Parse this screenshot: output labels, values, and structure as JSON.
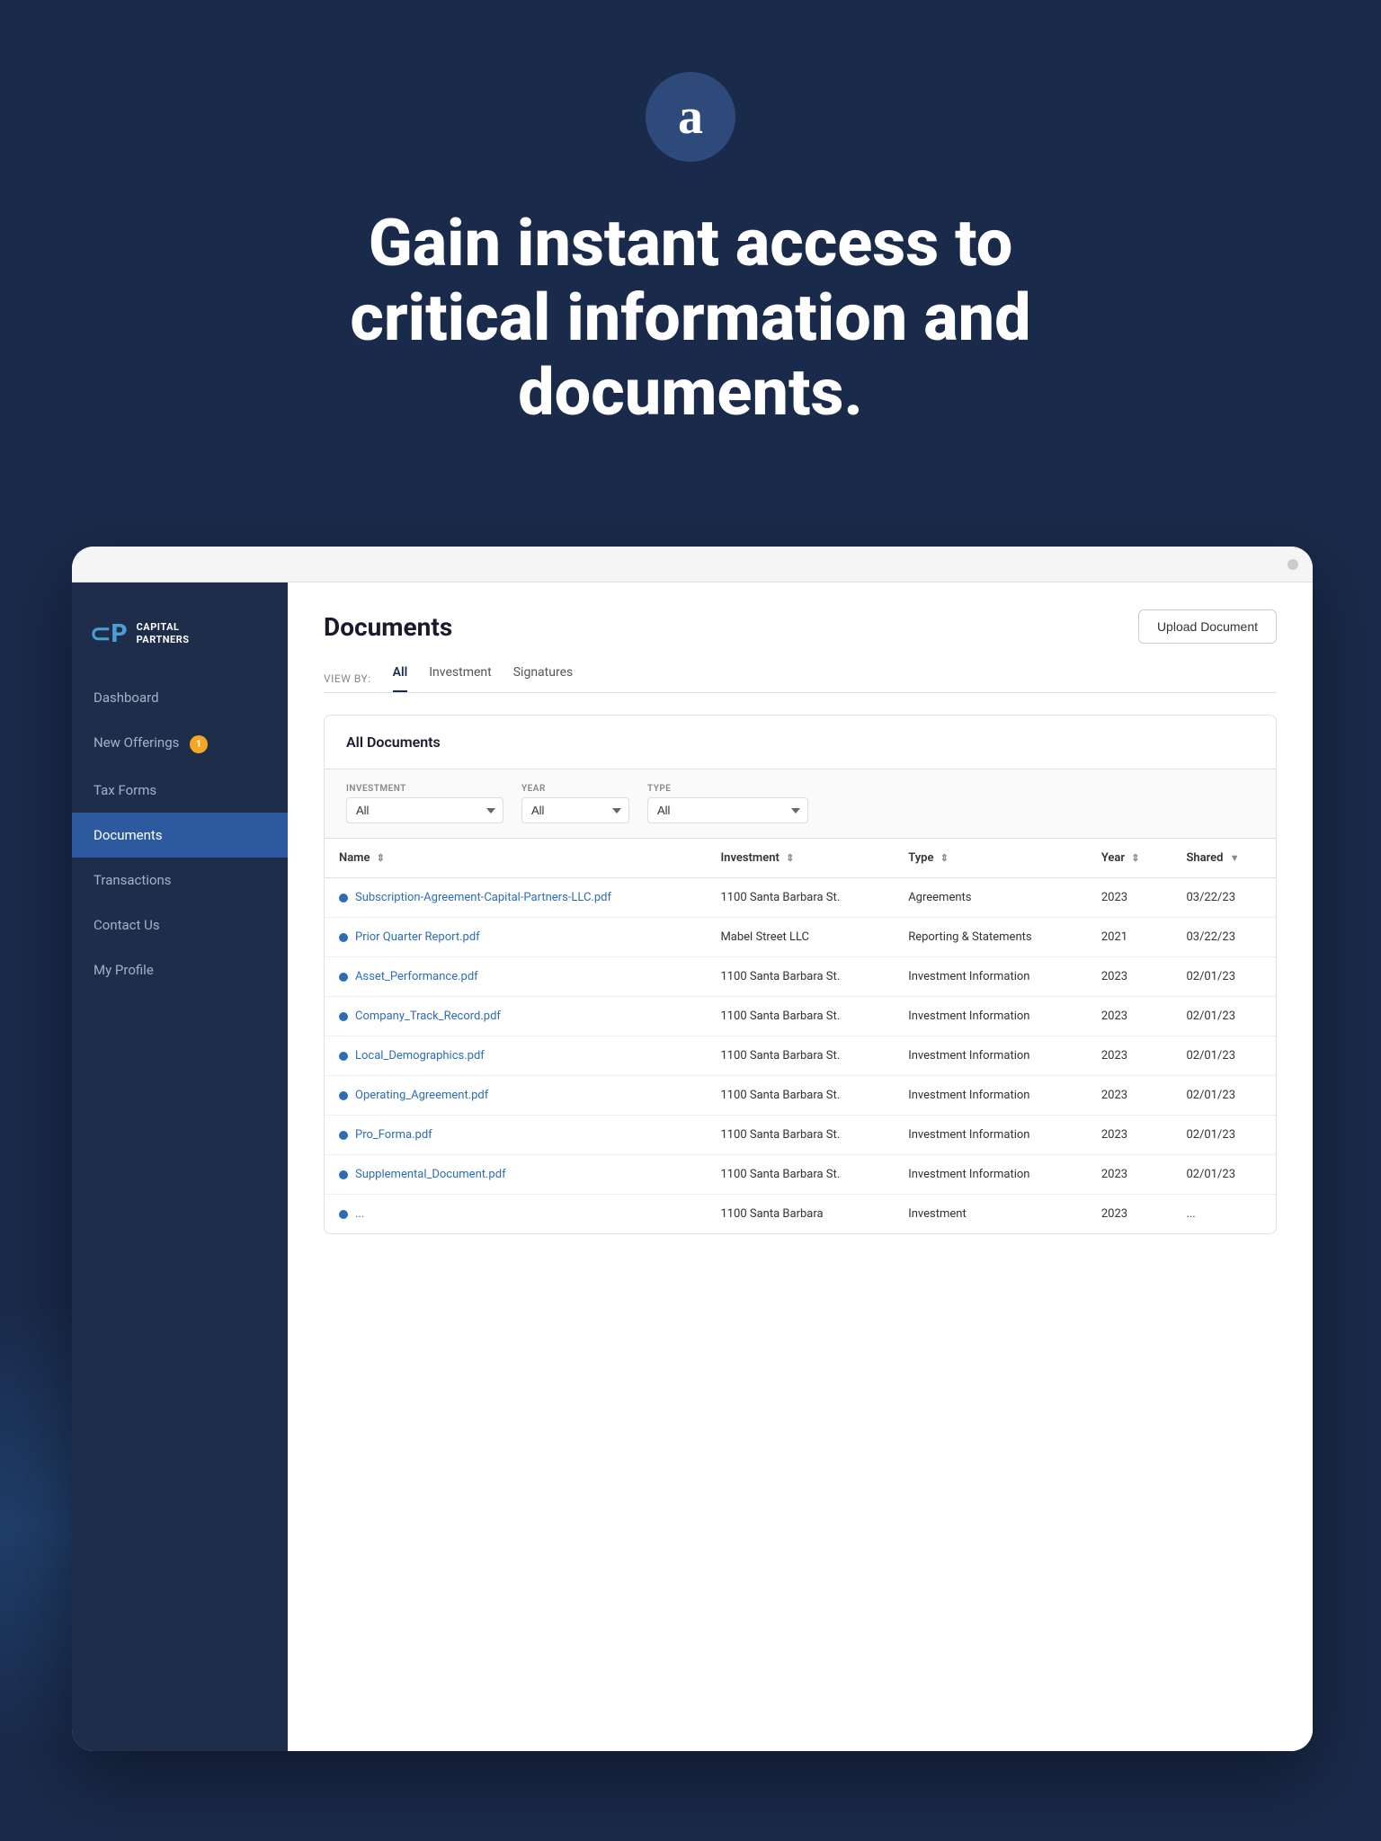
{
  "hero": {
    "logo_letter": "a",
    "title": "Gain instant access to critical information and documents."
  },
  "sidebar": {
    "logo_text": "CAPITAL\nPARTNERS",
    "nav_items": [
      {
        "label": "Dashboard",
        "active": false,
        "badge": null
      },
      {
        "label": "New Offerings",
        "active": false,
        "badge": "1"
      },
      {
        "label": "Tax Forms",
        "active": false,
        "badge": null
      },
      {
        "label": "Documents",
        "active": true,
        "badge": null
      },
      {
        "label": "Transactions",
        "active": false,
        "badge": null
      },
      {
        "label": "Contact Us",
        "active": false,
        "badge": null
      },
      {
        "label": "My Profile",
        "active": false,
        "badge": null
      }
    ]
  },
  "main": {
    "page_title": "Documents",
    "upload_button": "Upload Document",
    "view_by_label": "VIEW BY:",
    "tabs": [
      {
        "label": "All",
        "active": true
      },
      {
        "label": "Investment",
        "active": false
      },
      {
        "label": "Signatures",
        "active": false
      }
    ],
    "documents_card_title": "All Documents",
    "filters": {
      "investment": {
        "label": "INVESTMENT",
        "value": "All"
      },
      "year": {
        "label": "YEAR",
        "value": "All"
      },
      "type": {
        "label": "TYPE",
        "value": "All"
      }
    },
    "table": {
      "columns": [
        {
          "label": "Name",
          "sort": true
        },
        {
          "label": "Investment",
          "sort": true
        },
        {
          "label": "Type",
          "sort": true
        },
        {
          "label": "Year",
          "sort": true
        },
        {
          "label": "Shared",
          "sort": true,
          "sort_dir": "desc"
        }
      ],
      "rows": [
        {
          "name": "Subscription-Agreement-Capital-Partners-LLC.pdf",
          "investment": "1100 Santa Barbara St.",
          "type": "Agreements",
          "year": "2023",
          "shared": "03/22/23"
        },
        {
          "name": "Prior Quarter Report.pdf",
          "investment": "Mabel Street LLC",
          "type": "Reporting & Statements",
          "year": "2021",
          "shared": "03/22/23"
        },
        {
          "name": "Asset_Performance.pdf",
          "investment": "1100 Santa Barbara St.",
          "type": "Investment Information",
          "year": "2023",
          "shared": "02/01/23"
        },
        {
          "name": "Company_Track_Record.pdf",
          "investment": "1100 Santa Barbara St.",
          "type": "Investment Information",
          "year": "2023",
          "shared": "02/01/23"
        },
        {
          "name": "Local_Demographics.pdf",
          "investment": "1100 Santa Barbara St.",
          "type": "Investment Information",
          "year": "2023",
          "shared": "02/01/23"
        },
        {
          "name": "Operating_Agreement.pdf",
          "investment": "1100 Santa Barbara St.",
          "type": "Investment Information",
          "year": "2023",
          "shared": "02/01/23"
        },
        {
          "name": "Pro_Forma.pdf",
          "investment": "1100 Santa Barbara St.",
          "type": "Investment Information",
          "year": "2023",
          "shared": "02/01/23"
        },
        {
          "name": "Supplemental_Document.pdf",
          "investment": "1100 Santa Barbara St.",
          "type": "Investment Information",
          "year": "2023",
          "shared": "02/01/23"
        },
        {
          "name": "...",
          "investment": "1100 Santa Barbara",
          "type": "Investment",
          "year": "2023",
          "shared": "..."
        }
      ]
    }
  }
}
